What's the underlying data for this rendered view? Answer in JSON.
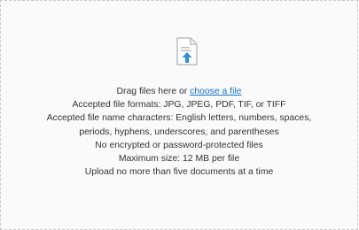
{
  "dropzone": {
    "icon": "file-upload-icon",
    "drag_text": "Drag files here or ",
    "choose_link": "choose a file",
    "formats": "Accepted file formats: JPG, JPEG, PDF, TIF, or TIFF",
    "name_chars_1": "Accepted file name characters: English letters, numbers, spaces,",
    "name_chars_2": "periods, hyphens, underscores, and parentheses",
    "encryption": "No encrypted or password-protected files",
    "max_size": "Maximum size: 12 MB per file",
    "limit": "Upload no more than five documents at a time"
  },
  "colors": {
    "link": "#1a73c6",
    "icon_arrow": "#2b8fdd",
    "icon_doc": "#bdbdbd"
  }
}
